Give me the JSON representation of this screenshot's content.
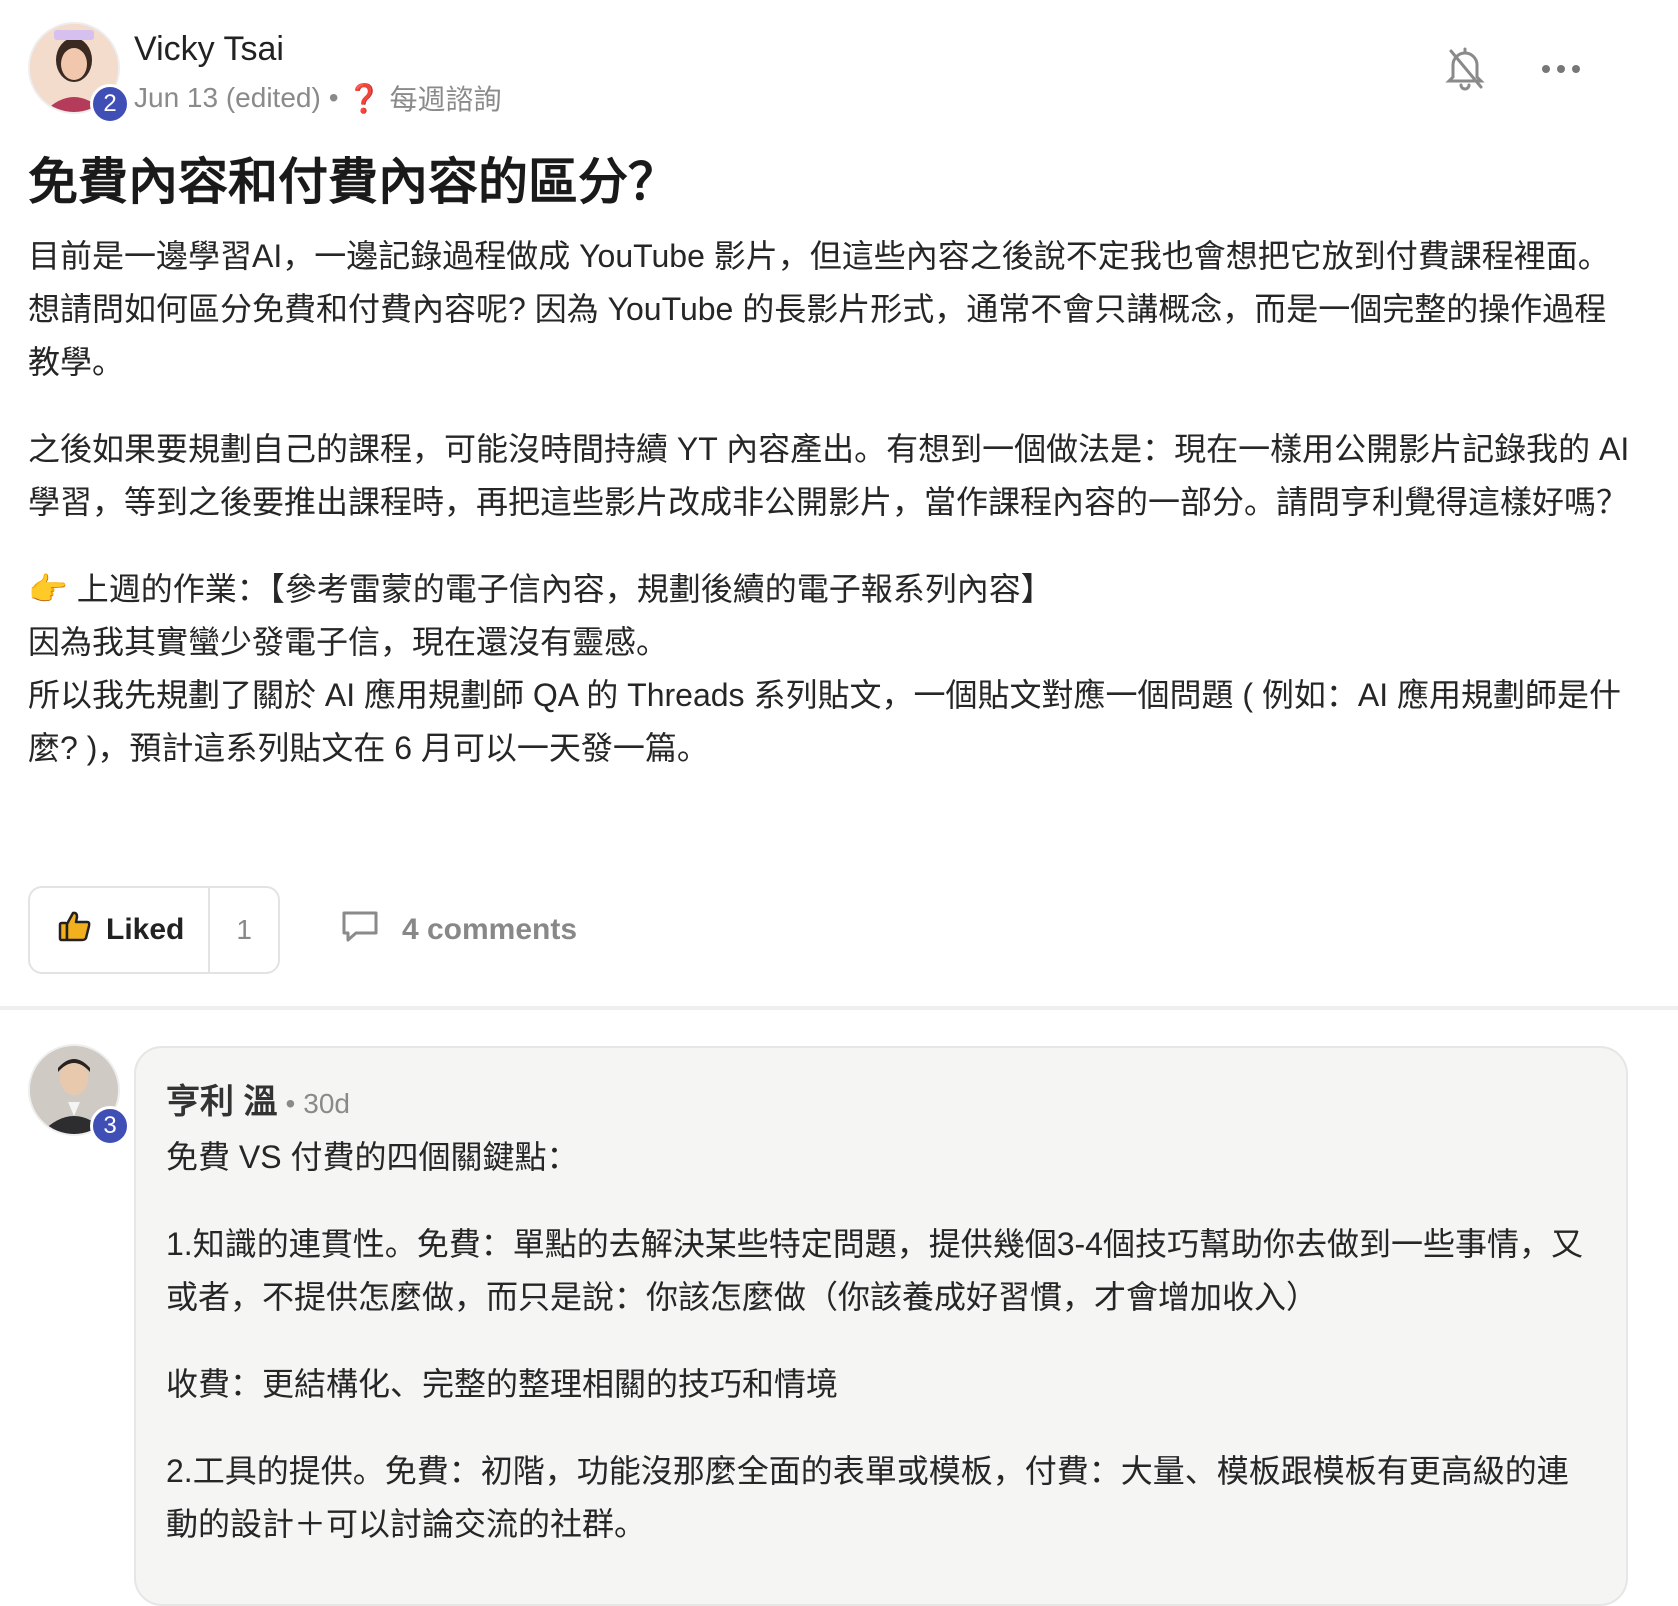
{
  "post": {
    "author": {
      "name": "Vicky Tsai",
      "level": "2",
      "avatar_icon": "user-avatar-icon"
    },
    "date": "Jun 13 (edited)",
    "separator": "•",
    "category_icon": "❓",
    "category": "每週諮詢",
    "title": "免費內容和付費內容的區分？",
    "paragraphs": [
      "目前是一邊學習AI，一邊記錄過程做成 YouTube 影片，但這些內容之後說不定我也會想把它放到付費課程裡面。想請問如何區分免費和付費內容呢? 因為 YouTube 的長影片形式，通常不會只講概念，而是一個完整的操作過程教學。",
      "之後如果要規劃自己的課程，可能沒時間持續 YT 內容產出。有想到一個做法是：現在一樣用公開影片記錄我的 AI 學習，等到之後要推出課程時，再把這些影片改成非公開影片，當作課程內容的一部分。請問亨利覺得這樣好嗎？"
    ],
    "homework": {
      "emoji": "👉",
      "line1": "上週的作業：【參考雷蒙的電子信內容，規劃後續的電子報系列內容】",
      "line2": "因為我其實蠻少發電子信，現在還沒有靈感。",
      "line3": "所以我先規劃了關於 AI 應用規劃師 QA 的 Threads 系列貼文，一個貼文對應一個問題 ( 例如：AI 應用規劃師是什麼? )，預計這系列貼文在 6 月可以一天發一篇。"
    },
    "actions": {
      "like_label": "Liked",
      "like_count": "1",
      "comments_label": "4 comments"
    }
  },
  "comment": {
    "author": "亨利 溫",
    "level": "3",
    "separator": "•",
    "time": "30d",
    "paragraphs": [
      "免費 VS 付費的四個關鍵點：",
      "1.知識的連貫性。免費：單點的去解決某些特定問題，提供幾個3-4個技巧幫助你去做到一些事情，又或者，不提供怎麼做，而只是說：你該怎麼做（你該養成好習慣，才會增加收入）",
      "收費：更結構化、完整的整理相關的技巧和情境",
      "2.工具的提供。免費：初階，功能沒那麼全面的表單或模板，付費：大量、模板跟模板有更高級的連動的設計＋可以討論交流的社群。"
    ]
  },
  "colors": {
    "badge": "#3f4fb6",
    "muted": "#8a8a8a",
    "bubble_bg": "#f5f5f4",
    "question_mark": "#e03a2e"
  }
}
